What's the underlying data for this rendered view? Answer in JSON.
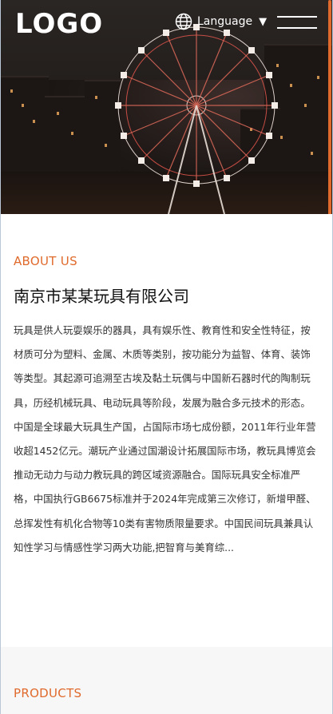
{
  "header": {
    "logo_text": "LOGO",
    "language_label": "Language",
    "language_caret": "▼",
    "icons": {
      "language": "globe-icon",
      "menu": "hamburger-menu-icon",
      "caret": "caret-down-icon"
    }
  },
  "hero": {
    "image": "ferris-wheel-night-city-photo"
  },
  "about": {
    "eyebrow": "ABOUT US",
    "company_name": "南京市某某玩具有限公司",
    "body": "玩具是供人玩耍娱乐的器具，具有娱乐性、教育性和安全性特征，按材质可分为塑料、金属、木质等类别，按功能分为益智、体育、装饰等类型。其起源可追溯至古埃及黏土玩偶与中国新石器时代的陶制玩具，历经机械玩具、电动玩具等阶段，发展为融合多元技术的形态。中国是全球最大玩具生产国，占国际市场七成份额，2011年行业年营收超1452亿元。潮玩产业通过国潮设计拓展国际市场，教玩具博览会推动无动力与动力教玩具的跨区域资源融合。国际玩具安全标准严格，中国执行GB6675标准并于2024年完成第三次修订，新增甲醛、总挥发性有机化合物等10类有害物质限量要求。中国民间玩具兼具认知性学习与情感性学习两大功能,把智育与美育综..."
  },
  "products": {
    "eyebrow": "PRODUCTS"
  },
  "colors": {
    "accent": "#e06a2c",
    "text": "#333333",
    "section_bg": "#f7f7f7"
  }
}
